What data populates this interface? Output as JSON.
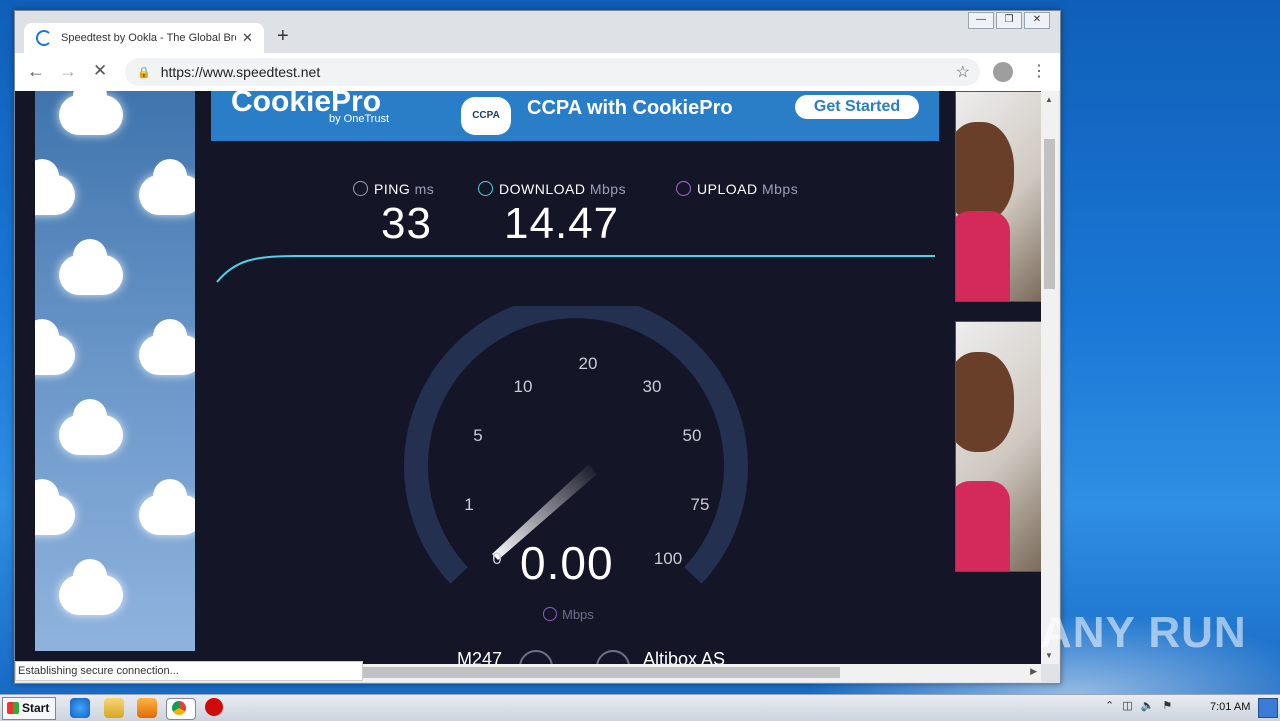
{
  "browser": {
    "tab_title": "Speedtest by Ookla - The Global Bro",
    "tab_close": "✕",
    "new_tab": "+",
    "url": "https://www.speedtest.net",
    "controls": {
      "minimize": "—",
      "restore": "❐",
      "close": "✕"
    },
    "status_text": "Establishing secure connection..."
  },
  "ad": {
    "brand": "CookiePro",
    "brand_by": "by OneTrust",
    "seal_text": "CCPA",
    "headline": "CCPA with CookiePro",
    "cta": "Get Started"
  },
  "speedtest": {
    "ping": {
      "label": "PING",
      "unit": "ms",
      "value": "33"
    },
    "download": {
      "label": "DOWNLOAD",
      "unit": "Mbps",
      "value": "14.47"
    },
    "upload": {
      "label": "UPLOAD",
      "unit": "Mbps",
      "value": ""
    },
    "gauge": {
      "value": "0.00",
      "unit": "Mbps",
      "ticks": [
        "0",
        "1",
        "5",
        "10",
        "20",
        "30",
        "50",
        "75",
        "100"
      ],
      "needle_value": 0
    },
    "server": {
      "isp": "M247",
      "host": "Altibox AS"
    },
    "colors": {
      "accent_line": "#4fd1e6",
      "gauge_track": "#23304f",
      "upload_icon": "#a76bd6",
      "background": "#141526"
    }
  },
  "watermark": "ANY RUN",
  "taskbar": {
    "start_label": "Start",
    "clock": "7:01 AM"
  }
}
